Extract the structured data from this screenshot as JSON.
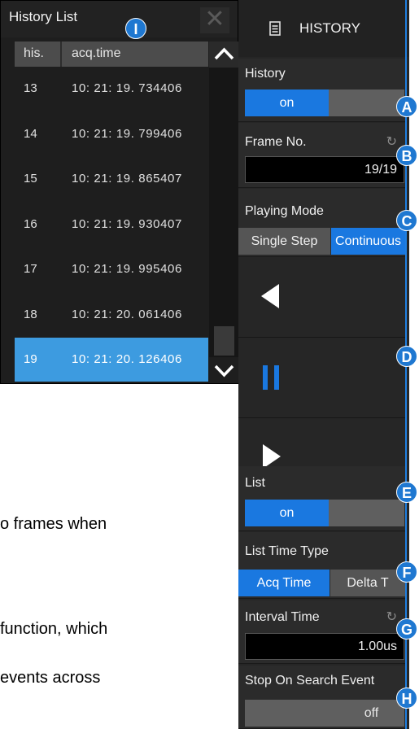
{
  "history_list": {
    "title": "History List",
    "close_glyph": "✕",
    "badge": "I",
    "columns": [
      "his.",
      "acq.time"
    ],
    "rows": [
      {
        "his": "13",
        "acq_time": "10: 21: 19. 734406"
      },
      {
        "his": "14",
        "acq_time": "10: 21: 19. 799406"
      },
      {
        "his": "15",
        "acq_time": "10: 21: 19. 865407"
      },
      {
        "his": "16",
        "acq_time": "10: 21: 19. 930407"
      },
      {
        "his": "17",
        "acq_time": "10: 21: 19. 995406"
      },
      {
        "his": "18",
        "acq_time": "10: 21: 20. 061406"
      },
      {
        "his": "19",
        "acq_time": "10: 21: 20. 126406"
      }
    ],
    "selected_his": "19"
  },
  "menu": {
    "title": "HISTORY",
    "title_icon": "list-document-icon",
    "history": {
      "label": "History",
      "on": "on",
      "badge": "A"
    },
    "frame_no": {
      "label": "Frame No.",
      "value": "19/19",
      "badge": "B"
    },
    "playing_mode": {
      "label": "Playing Mode",
      "options": [
        "Single Step",
        "Continuous"
      ],
      "selected": "Continuous",
      "badge": "C"
    },
    "play_controls": {
      "badge": "D",
      "icons": [
        "play-backward-icon",
        "pause-icon",
        "play-forward-icon"
      ]
    },
    "list": {
      "label": "List",
      "on": "on",
      "badge": "E"
    },
    "list_time_type": {
      "label": "List Time Type",
      "options": [
        "Acq Time",
        "Delta T"
      ],
      "selected": "Acq Time",
      "badge": "F"
    },
    "interval_time": {
      "label": "Interval Time",
      "value": "1.00us",
      "badge": "G"
    },
    "stop_on_search_event": {
      "label": "Stop On Search Event",
      "off": "off",
      "badge": "H"
    }
  },
  "background_text": {
    "line1": "o frames when",
    "line2": "function, which",
    "line3": " events across"
  },
  "colors": {
    "accent": "#1a78e0",
    "selected_row": "#3d9be0",
    "badge": "#1f78d1"
  }
}
